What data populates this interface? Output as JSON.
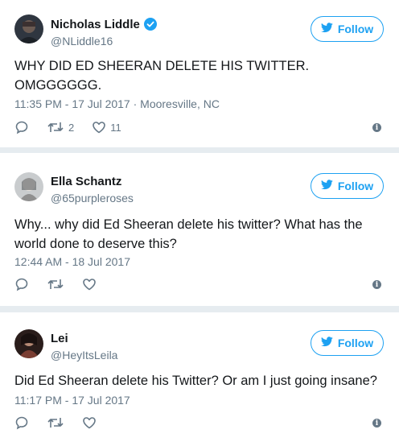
{
  "tweets": [
    {
      "name": "Nicholas Liddle",
      "handle": "@NLiddle16",
      "verified": true,
      "follow_label": "Follow",
      "text": "WHY DID ED SHEERAN DELETE HIS TWITTER. OMGGGGGG.",
      "timestamp": "11:35 PM - 17 Jul 2017 · Mooresville, NC",
      "retweets": "2",
      "likes": "11"
    },
    {
      "name": "Ella Schantz",
      "handle": "@65purpleroses",
      "verified": false,
      "follow_label": "Follow",
      "text": "Why... why did Ed Sheeran delete his twitter? What has the world done to deserve this?",
      "timestamp": "12:44 AM - 18 Jul 2017",
      "retweets": "",
      "likes": ""
    },
    {
      "name": "Lei",
      "handle": "@HeyItsLeila",
      "verified": false,
      "follow_label": "Follow",
      "text": "Did Ed Sheeran delete his Twitter? Or am I just going insane?",
      "timestamp": "11:17 PM - 17 Jul 2017",
      "retweets": "",
      "likes": ""
    }
  ],
  "colors": {
    "accent": "#1da1f2",
    "secondary_text": "#657786",
    "primary_text": "#14171a",
    "divider_background": "#e6ecf0"
  },
  "icons": [
    "reply-icon",
    "retweet-icon",
    "like-icon",
    "info-icon",
    "twitter-bird-icon",
    "verified-badge-icon"
  ]
}
